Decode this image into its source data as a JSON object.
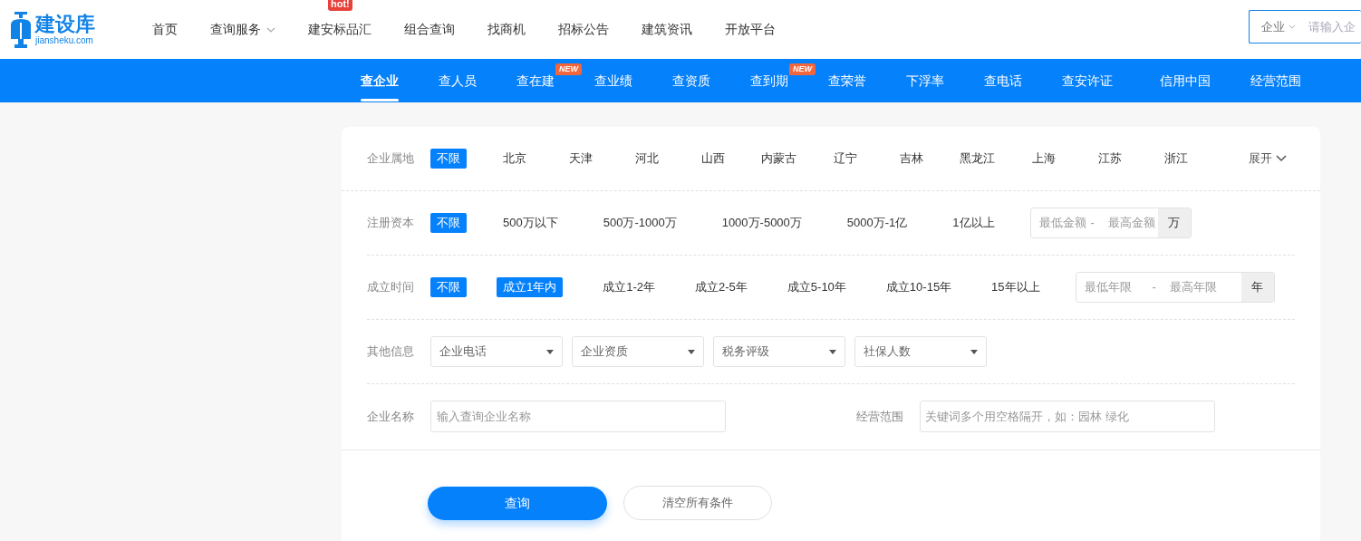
{
  "logo": {
    "name": "建设库",
    "domain": "jiansheku.com"
  },
  "nav": [
    {
      "label": "首页",
      "dropdown": false
    },
    {
      "label": "查询服务",
      "dropdown": true
    },
    {
      "label": "建安标品汇",
      "dropdown": false,
      "badge": "hot!"
    },
    {
      "label": "组合查询",
      "dropdown": false
    },
    {
      "label": "找商机",
      "dropdown": false
    },
    {
      "label": "招标公告",
      "dropdown": false
    },
    {
      "label": "建筑资讯",
      "dropdown": false
    },
    {
      "label": "开放平台",
      "dropdown": false
    }
  ],
  "search": {
    "type": "企业",
    "placeholder": "请输入企"
  },
  "tabs": [
    {
      "label": "查企业",
      "selected": true
    },
    {
      "label": "查人员",
      "selected": false
    },
    {
      "label": "查在建",
      "selected": false,
      "badge": "NEW"
    },
    {
      "label": "查业绩",
      "selected": false
    },
    {
      "label": "查资质",
      "selected": false
    },
    {
      "label": "查到期",
      "selected": false,
      "badge": "NEW"
    },
    {
      "label": "查荣誉",
      "selected": false
    },
    {
      "label": "下浮率",
      "selected": false
    },
    {
      "label": "查电话",
      "selected": false
    },
    {
      "label": "查安许证",
      "selected": false
    },
    {
      "label": "信用中国",
      "selected": false
    },
    {
      "label": "经营范围",
      "selected": false
    }
  ],
  "filters": [
    {
      "kind": "regions",
      "label": "企业属地",
      "expand": "展开",
      "options": [
        {
          "label": "不限",
          "selected": true
        },
        {
          "label": "北京",
          "selected": false
        },
        {
          "label": "天津",
          "selected": false
        },
        {
          "label": "河北",
          "selected": false
        },
        {
          "label": "山西",
          "selected": false
        },
        {
          "label": "内蒙古",
          "selected": false
        },
        {
          "label": "辽宁",
          "selected": false
        },
        {
          "label": "吉林",
          "selected": false
        },
        {
          "label": "黑龙江",
          "selected": false
        },
        {
          "label": "上海",
          "selected": false
        },
        {
          "label": "江苏",
          "selected": false
        },
        {
          "label": "浙江",
          "selected": false
        }
      ]
    },
    {
      "kind": "range",
      "label": "注册资本",
      "options": [
        {
          "label": "不限",
          "selected": true
        },
        {
          "label": "500万以下",
          "selected": false
        },
        {
          "label": "500万-1000万",
          "selected": false
        },
        {
          "label": "1000万-5000万",
          "selected": false
        },
        {
          "label": "5000万-1亿",
          "selected": false
        },
        {
          "label": "1亿以上",
          "selected": false
        }
      ],
      "min_placeholder": "最低金额",
      "separator": "-",
      "max_placeholder": "最高金额",
      "unit": "万"
    },
    {
      "kind": "range",
      "label": "成立时间",
      "options": [
        {
          "label": "不限",
          "selected": true
        },
        {
          "label": "成立1年内",
          "selected": true
        },
        {
          "label": "成立1-2年",
          "selected": false
        },
        {
          "label": "成立2-5年",
          "selected": false
        },
        {
          "label": "成立5-10年",
          "selected": false
        },
        {
          "label": "成立10-15年",
          "selected": false
        },
        {
          "label": "15年以上",
          "selected": false
        }
      ],
      "min_placeholder": "最低年限",
      "separator": "-",
      "max_placeholder": "最高年限",
      "unit": "年"
    },
    {
      "kind": "selects",
      "label": "其他信息",
      "selects": [
        "企业电话",
        "企业资质",
        "税务评级",
        "社保人数"
      ]
    },
    {
      "kind": "names",
      "label": "企业名称",
      "placeholder": "输入查询企业名称",
      "scope_label": "经营范围",
      "scope_placeholder": "关键词多个用空格隔开，如：园林 绿化"
    }
  ],
  "buttons": {
    "search": "查询",
    "clear": "清空所有条件"
  }
}
